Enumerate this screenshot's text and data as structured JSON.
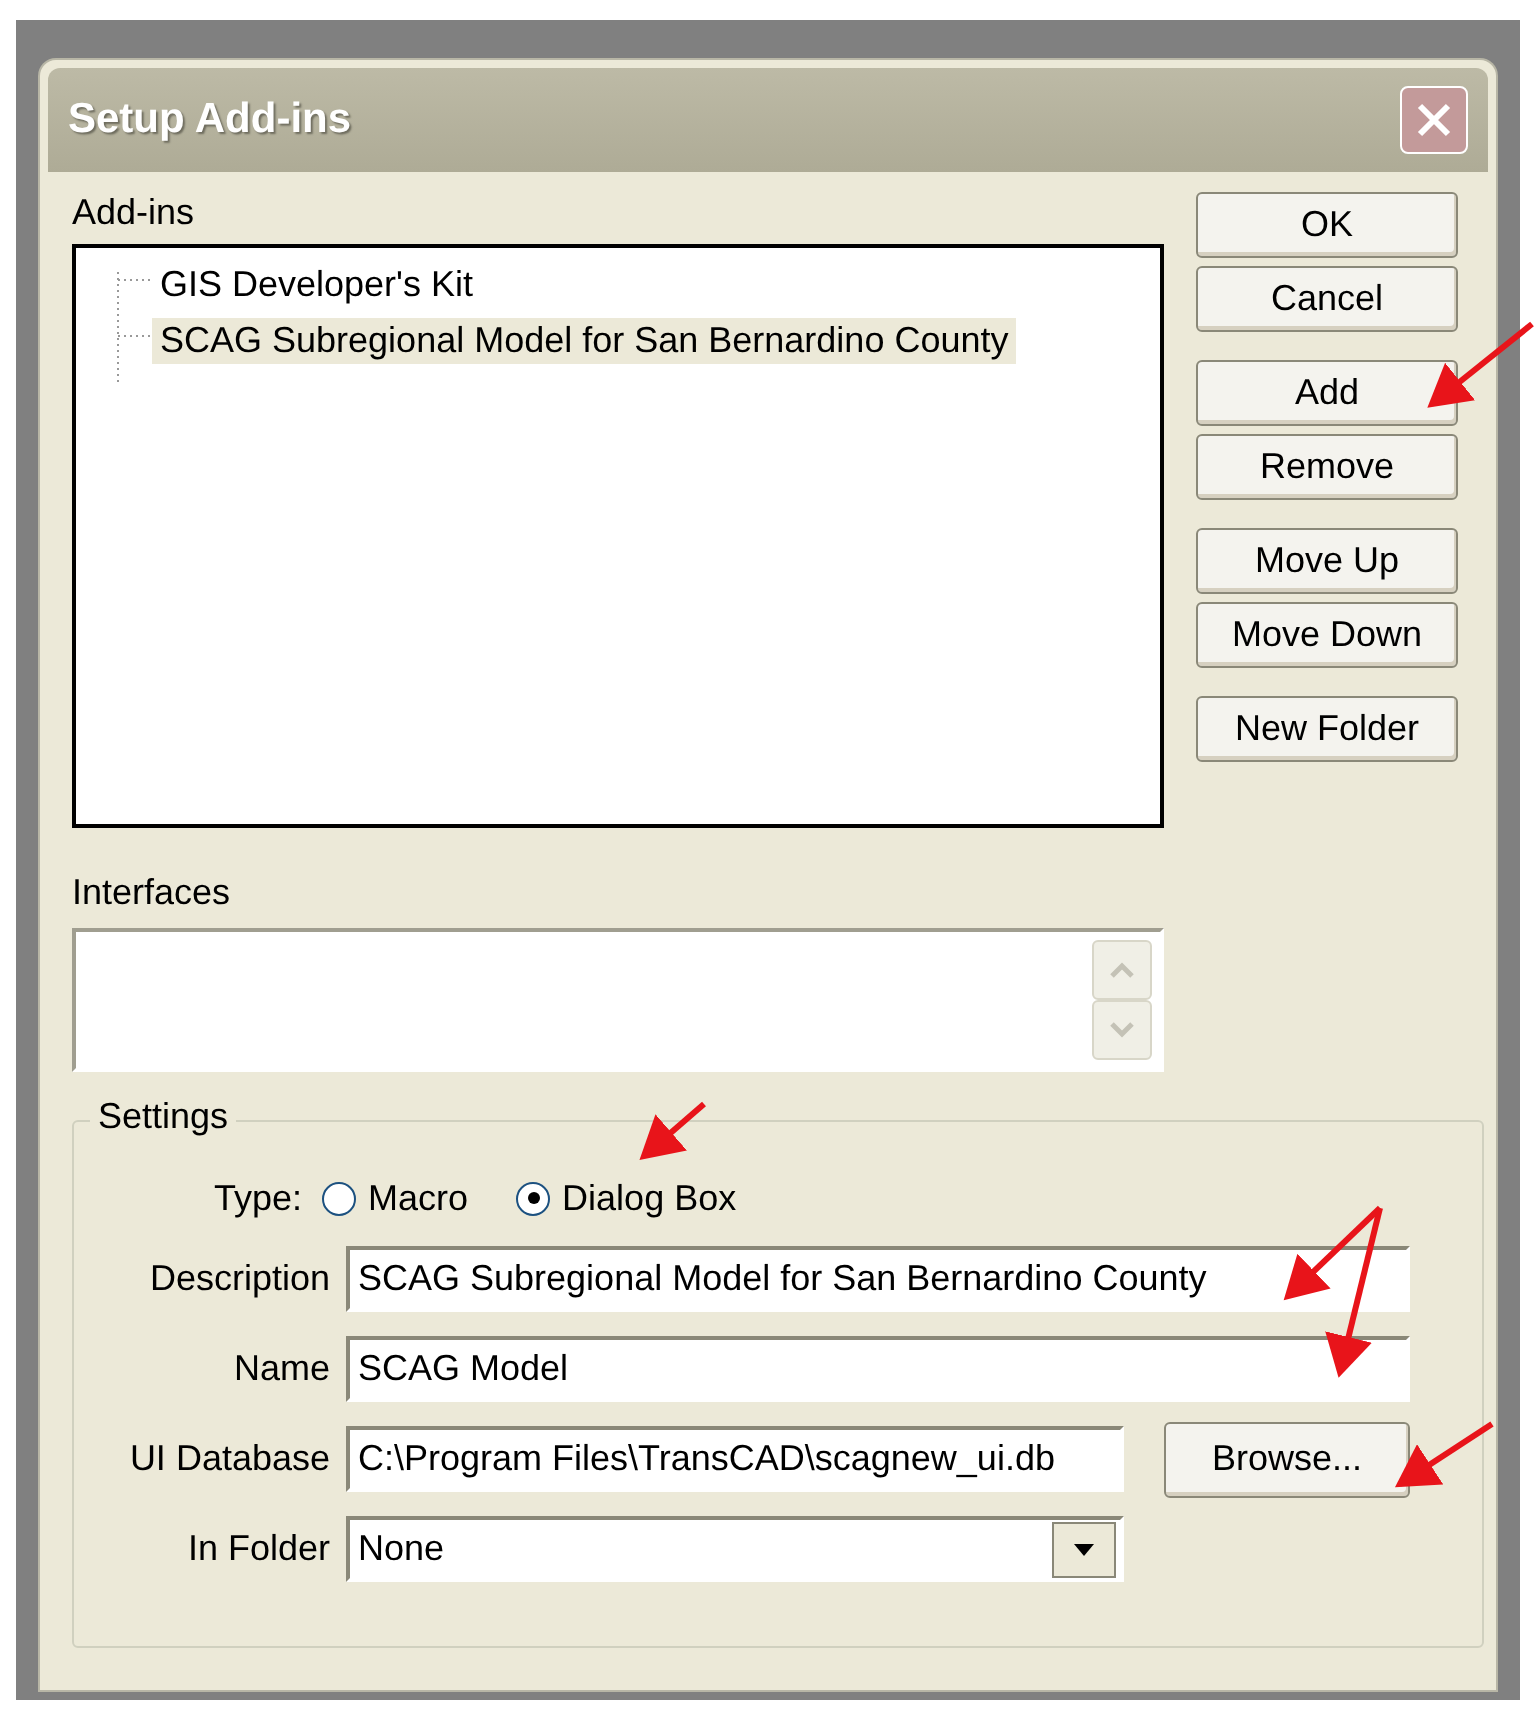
{
  "window": {
    "title": "Setup Add-ins",
    "active": false
  },
  "addins": {
    "label": "Add-ins",
    "items": [
      {
        "label": "GIS Developer's Kit",
        "selected": false
      },
      {
        "label": "SCAG Subregional Model for San Bernardino County",
        "selected": true
      }
    ]
  },
  "button_groups": [
    [
      "OK",
      "Cancel"
    ],
    [
      "Add",
      "Remove"
    ],
    [
      "Move Up",
      "Move Down"
    ],
    [
      "New Folder"
    ]
  ],
  "interfaces": {
    "label": "Interfaces"
  },
  "settings": {
    "label": "Settings",
    "type": {
      "label": "Type:",
      "options": [
        {
          "label": "Macro",
          "selected": false
        },
        {
          "label": "Dialog Box",
          "selected": true
        }
      ]
    },
    "fields": [
      {
        "kind": "text",
        "label": "Description",
        "value": "SCAG Subregional Model for San Bernardino County"
      },
      {
        "kind": "text",
        "label": "Name",
        "value": "SCAG Model"
      },
      {
        "kind": "browse",
        "label": "UI Database",
        "value": "C:\\Program Files\\TransCAD\\scagnew_ui.db",
        "button": "Browse..."
      },
      {
        "kind": "dropdown",
        "label": "In Folder",
        "value": "None"
      }
    ]
  }
}
